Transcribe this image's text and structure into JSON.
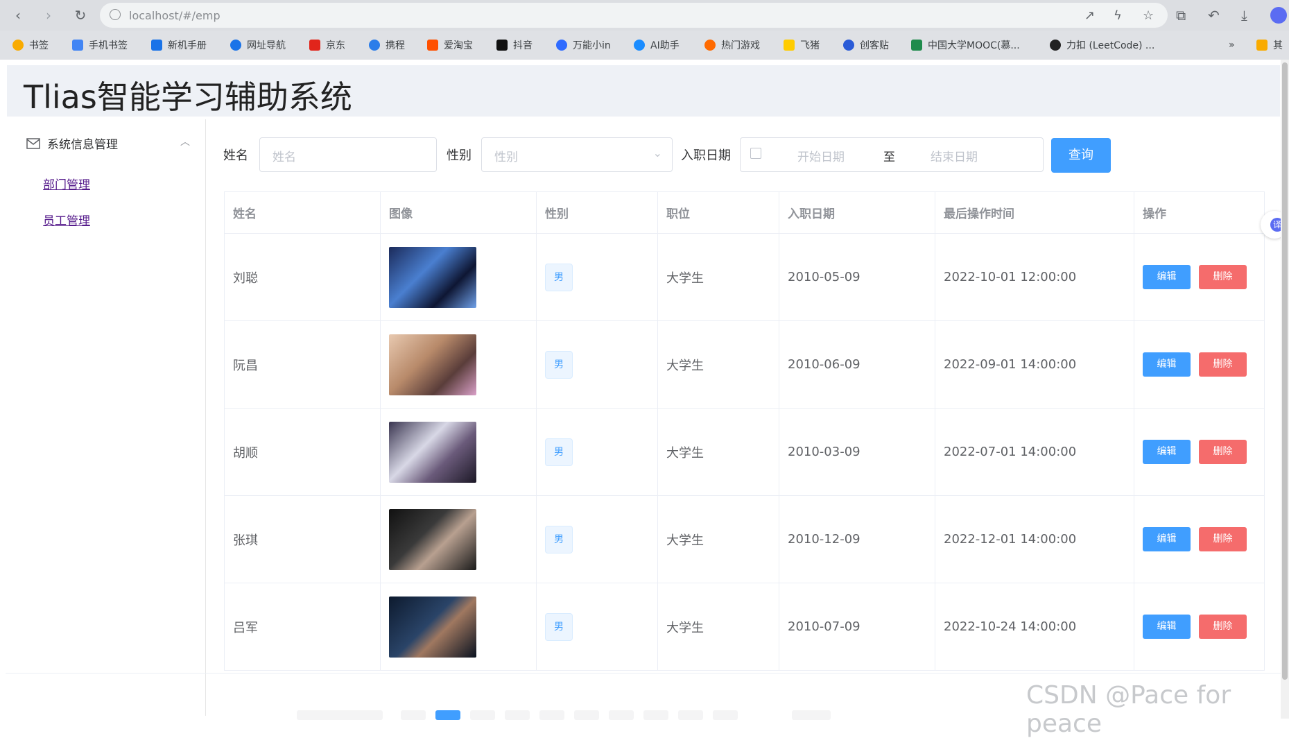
{
  "browser": {
    "url": "localhost/#/emp",
    "bookmarks": [
      "书签",
      "手机书签",
      "新机手册",
      "网址导航",
      "京东",
      "携程",
      "爱淘宝",
      "抖音",
      "万能小in",
      "AI助手",
      "热门游戏",
      "飞猪",
      "创客贴",
      "中国大学MOOC(慕...",
      "力扣 (LeetCode) ...",
      "其"
    ],
    "bookmark_colors": [
      "#f9ab00",
      "#4285f4",
      "#1a73e8",
      "#1a73e8",
      "#e1251b",
      "#2b7de9",
      "#ff5000",
      "#111111",
      "#2f6bff",
      "#1a8cff",
      "#ff6a00",
      "#ffcc00",
      "#2a5bd7",
      "#1f8b4c",
      "#222222",
      "#f9ab00"
    ]
  },
  "app": {
    "title": "Tlias智能学习辅助系统"
  },
  "sidebar": {
    "group_label": "系统信息管理",
    "items": [
      {
        "label": "部门管理"
      },
      {
        "label": "员工管理"
      }
    ]
  },
  "search": {
    "name_label": "姓名",
    "name_placeholder": "姓名",
    "gender_label": "性别",
    "gender_placeholder": "性别",
    "date_label": "入职日期",
    "start_placeholder": "开始日期",
    "range_sep": "至",
    "end_placeholder": "结束日期",
    "query_button": "查询"
  },
  "table": {
    "headers": [
      "姓名",
      "图像",
      "性别",
      "职位",
      "入职日期",
      "最后操作时间",
      "操作"
    ],
    "rows": [
      {
        "name": "刘聪",
        "gender": "男",
        "position": "大学生",
        "entry_date": "2010-05-09",
        "update_time": "2022-10-01 12:00:00"
      },
      {
        "name": "阮昌",
        "gender": "男",
        "position": "大学生",
        "entry_date": "2010-06-09",
        "update_time": "2022-09-01 14:00:00"
      },
      {
        "name": "胡顺",
        "gender": "男",
        "position": "大学生",
        "entry_date": "2010-03-09",
        "update_time": "2022-07-01 14:00:00"
      },
      {
        "name": "张琪",
        "gender": "男",
        "position": "大学生",
        "entry_date": "2010-12-09",
        "update_time": "2022-12-01 14:00:00"
      },
      {
        "name": "吕军",
        "gender": "男",
        "position": "大学生",
        "entry_date": "2010-07-09",
        "update_time": "2022-10-24 14:00:00"
      }
    ],
    "edit_label": "编辑",
    "delete_label": "删除"
  },
  "overlay": {
    "translate_icon": "译",
    "watermark": "CSDN @Pace for peace"
  },
  "colors": {
    "primary": "#409eff",
    "danger": "#f56c6c",
    "header_bg": "#eef1f6"
  }
}
